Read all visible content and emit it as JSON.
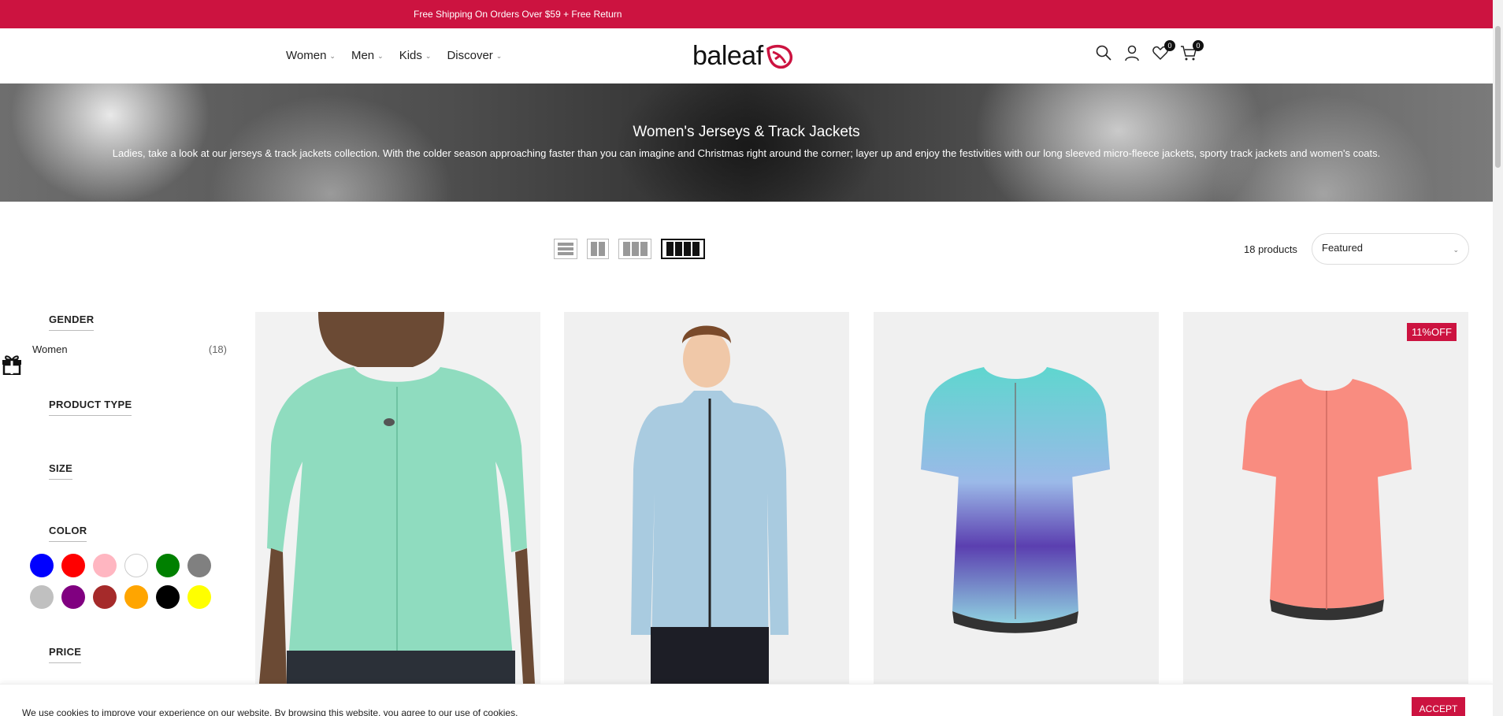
{
  "announcement": {
    "text": "Free Shipping On Orders Over $59 + Free Return"
  },
  "nav": [
    {
      "label": "Women"
    },
    {
      "label": "Men"
    },
    {
      "label": "Kids"
    },
    {
      "label": "Discover"
    }
  ],
  "logo": {
    "text": "baleaf"
  },
  "header_icons": {
    "wishlist_count": "0",
    "cart_count": "0"
  },
  "hero": {
    "title": "Women's Jerseys & Track Jackets",
    "description": "Ladies, take a look at our jerseys & track jackets collection. With the colder season approaching faster than you can imagine and Christmas right around the corner; layer up and enjoy the festivities with our long sleeved micro-fleece jackets, sporty track jackets and women's coats."
  },
  "toolbar": {
    "product_count": "18 products",
    "sort_selected": "Featured",
    "active_view": "4-columns"
  },
  "filters": {
    "gender": {
      "heading": "GENDER",
      "options": [
        {
          "label": "Women",
          "count": "(18)"
        }
      ]
    },
    "product_type": {
      "heading": "PRODUCT TYPE"
    },
    "size": {
      "heading": "SIZE"
    },
    "color": {
      "heading": "COLOR",
      "swatches": [
        "#0000ff",
        "#ff0000",
        "#ffb6c1",
        "#ffffff",
        "#008000",
        "#808080",
        "#c0c0c0",
        "#800080",
        "#a52a2a",
        "#ffa500",
        "#000000",
        "#ffff00"
      ]
    },
    "price": {
      "heading": "PRICE"
    }
  },
  "products": [
    {
      "image": "mint-short-sleeve-jersey",
      "badge": ""
    },
    {
      "image": "light-blue-track-jacket",
      "badge": ""
    },
    {
      "image": "teal-watercolor-jersey",
      "badge": ""
    },
    {
      "image": "coral-hexagon-jersey",
      "badge": "11%OFF"
    }
  ],
  "cookie": {
    "text": "We use cookies to improve your experience on our website. By browsing this website, you agree to our use of cookies.",
    "accept_label": "ACCEPT"
  },
  "colors": {
    "brand": "#cc1340"
  }
}
